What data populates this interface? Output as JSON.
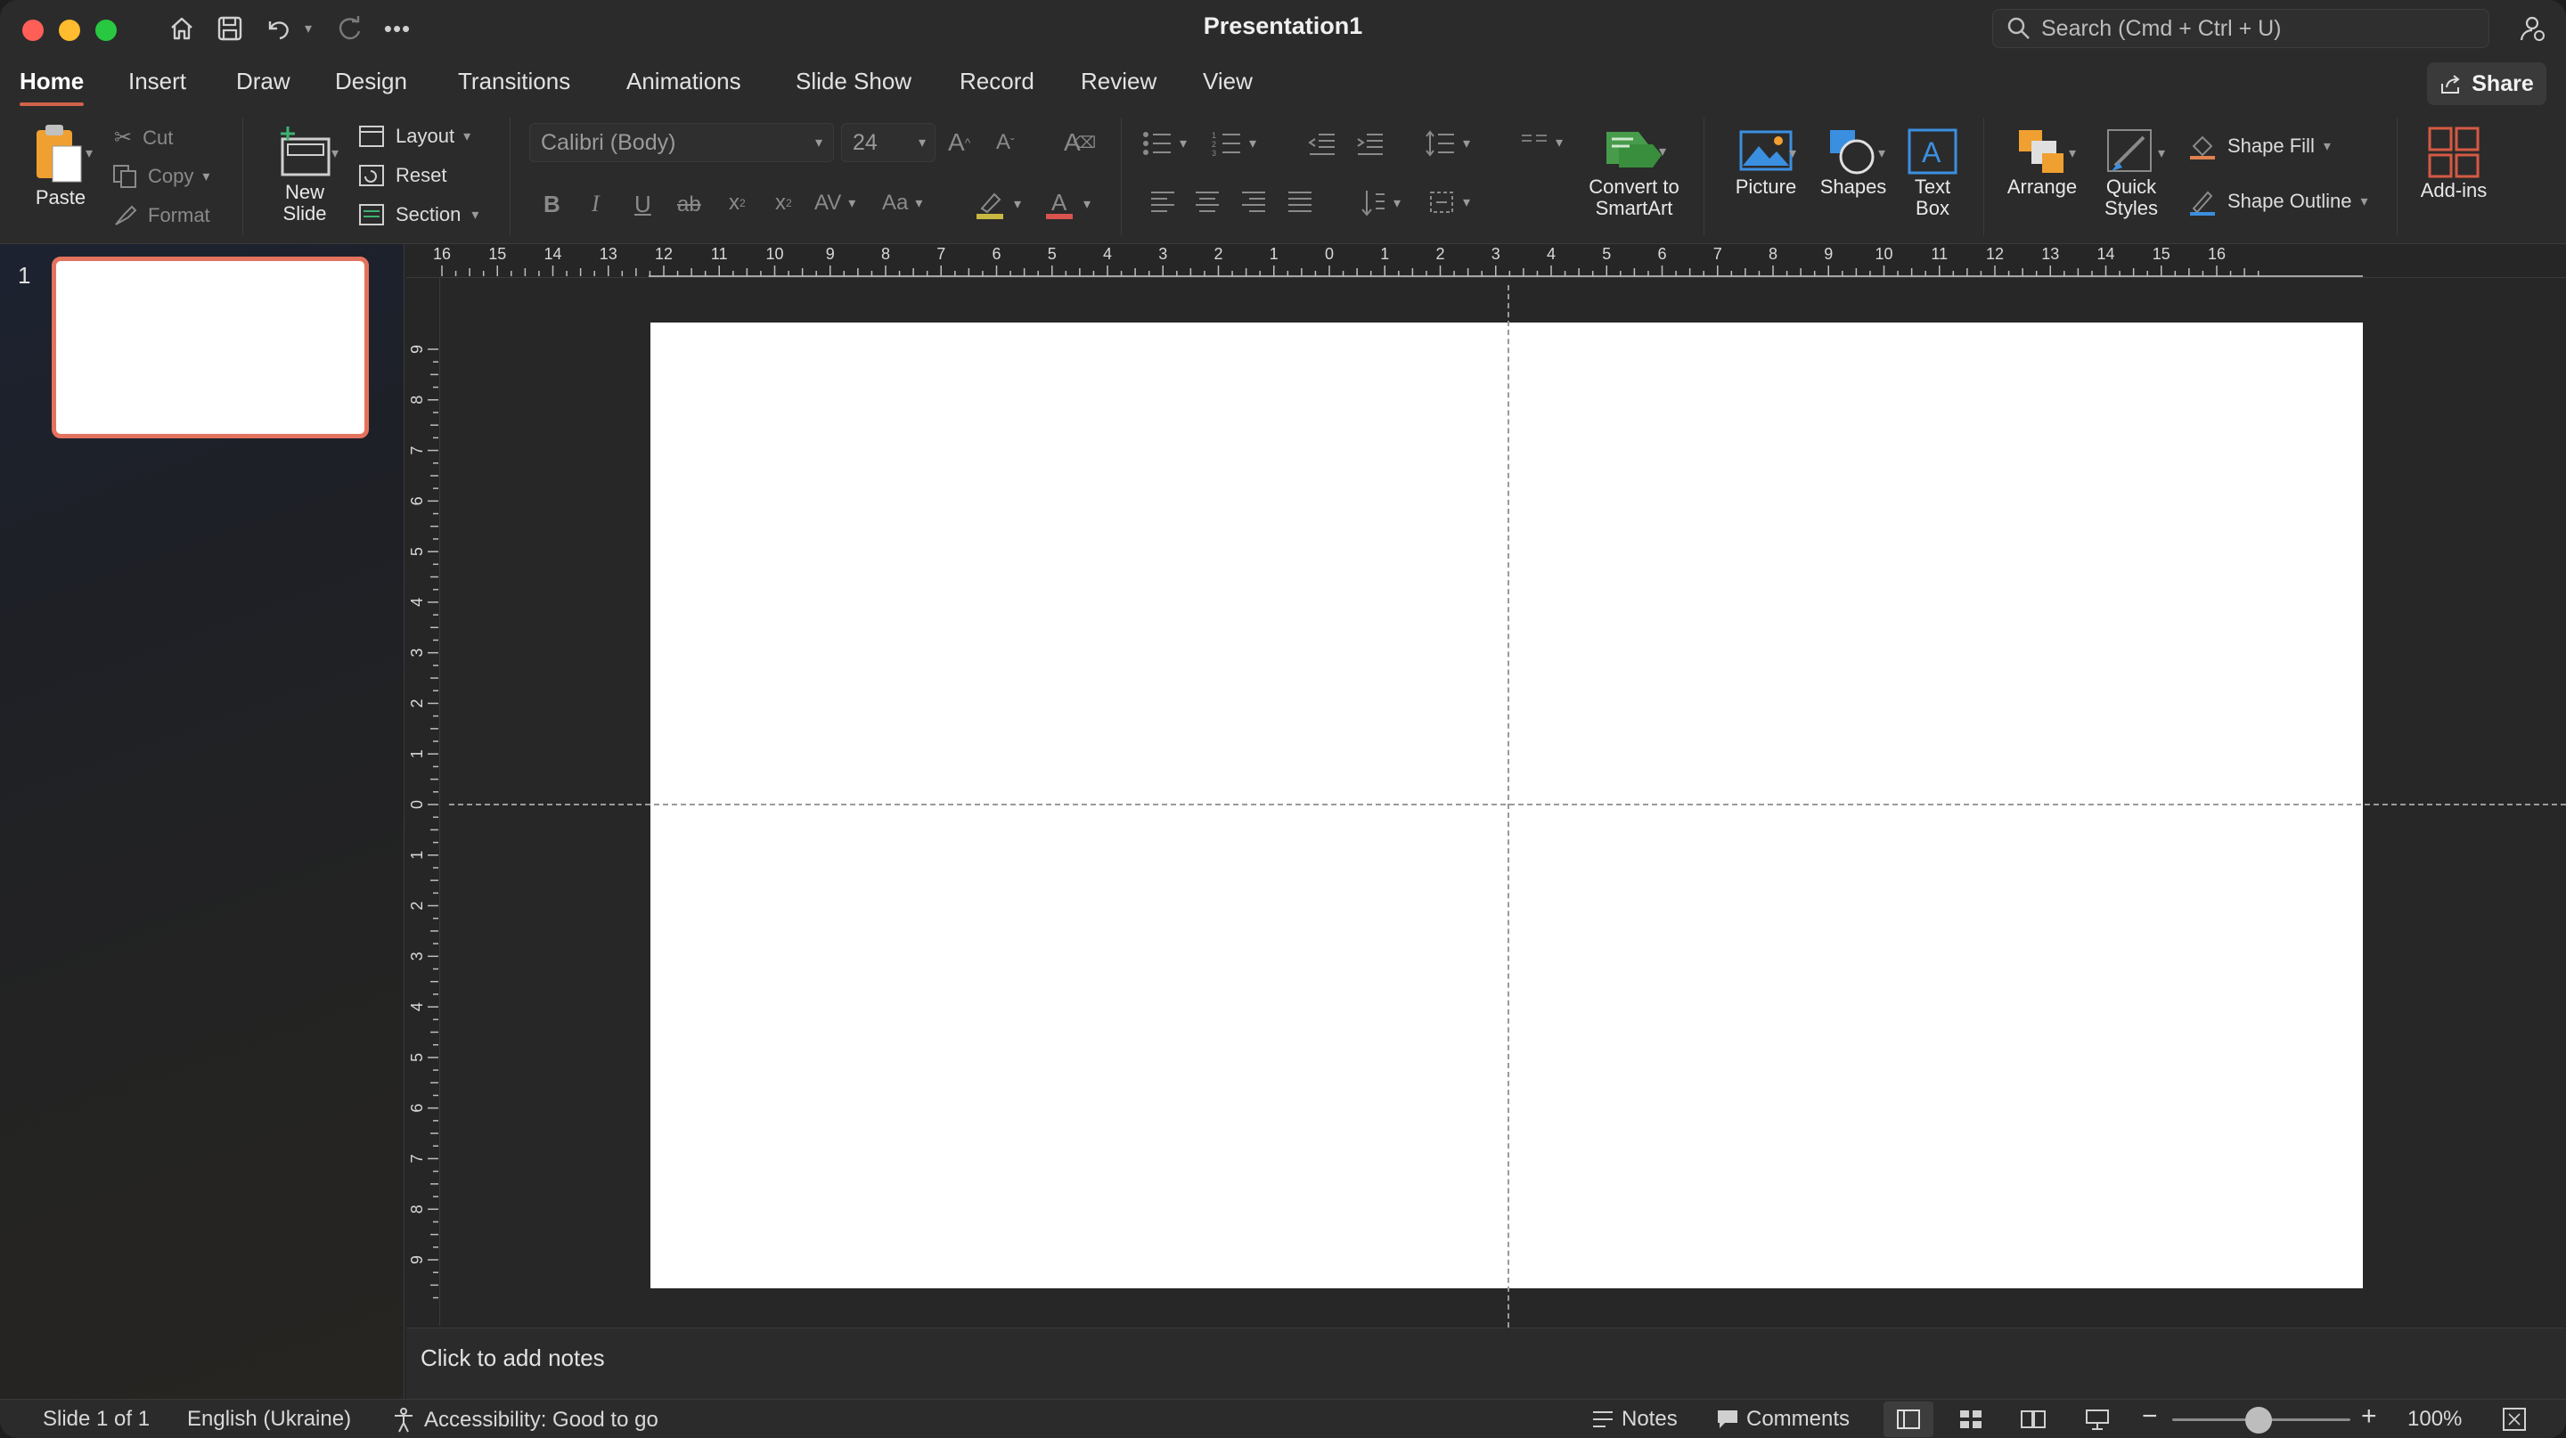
{
  "window": {
    "title": "Presentation1"
  },
  "search": {
    "placeholder": "Search (Cmd + Ctrl + U)"
  },
  "tabs": [
    {
      "label": "Home"
    },
    {
      "label": "Insert"
    },
    {
      "label": "Draw"
    },
    {
      "label": "Design"
    },
    {
      "label": "Transitions"
    },
    {
      "label": "Animations"
    },
    {
      "label": "Slide Show"
    },
    {
      "label": "Record"
    },
    {
      "label": "Review"
    },
    {
      "label": "View"
    }
  ],
  "share": {
    "label": "Share"
  },
  "ribbon": {
    "clipboard": {
      "paste": "Paste",
      "cut": "Cut",
      "copy": "Copy",
      "format": "Format"
    },
    "slides": {
      "new_slide_line1": "New",
      "new_slide_line2": "Slide",
      "layout": "Layout",
      "reset": "Reset",
      "section": "Section"
    },
    "font": {
      "name": "Calibri (Body)",
      "size": "24",
      "bold": "B",
      "italic": "I",
      "underline": "U",
      "strike": "ab",
      "superscript": "x",
      "subscript": "x",
      "spacing": "AV",
      "case": "Aa"
    },
    "smartart": {
      "line1": "Convert to",
      "line2": "SmartArt"
    },
    "insert": {
      "picture": "Picture",
      "shapes": "Shapes",
      "textbox_line1": "Text",
      "textbox_line2": "Box"
    },
    "drawing": {
      "arrange": "Arrange",
      "quick_line1": "Quick",
      "quick_line2": "Styles",
      "shape_fill": "Shape Fill",
      "shape_outline": "Shape Outline"
    },
    "addins": {
      "label": "Add-ins"
    }
  },
  "thumbnails": [
    {
      "number": "1"
    }
  ],
  "ruler": {
    "horizontal": [
      "16",
      "15",
      "14",
      "13",
      "12",
      "11",
      "10",
      "9",
      "8",
      "7",
      "6",
      "5",
      "4",
      "3",
      "2",
      "1",
      "0",
      "1",
      "2",
      "3",
      "4",
      "5",
      "6",
      "7",
      "8",
      "9",
      "10",
      "11",
      "12",
      "13",
      "14",
      "15",
      "16"
    ],
    "vertical": [
      "9",
      "8",
      "7",
      "6",
      "5",
      "4",
      "3",
      "2",
      "1",
      "0",
      "1",
      "2",
      "3",
      "4",
      "5",
      "6",
      "7",
      "8",
      "9"
    ]
  },
  "notes": {
    "placeholder": "Click to add notes"
  },
  "status": {
    "slide": "Slide 1 of 1",
    "language": "English (Ukraine)",
    "accessibility": "Accessibility: Good to go",
    "notes": "Notes",
    "comments": "Comments",
    "zoom": "100%",
    "zoom_percent": 100
  },
  "colors": {
    "accent": "#d0634a",
    "thumb_border": "#e3735e",
    "orange_icon": "#f0a030",
    "blue_icon": "#3b8fe0",
    "addins_icon": "#d45a43"
  }
}
